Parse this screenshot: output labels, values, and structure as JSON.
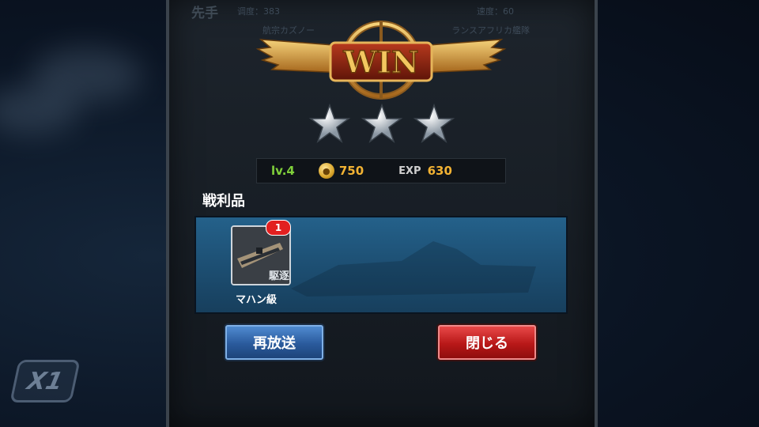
{
  "background": {
    "side_button_label": "X1"
  },
  "top_bar": {
    "left_title": "先手",
    "left_stat": "调度：383",
    "right_stat": "速度：60",
    "left_name": "航宗カズノー",
    "right_name": "ランスアフリカ艦隊"
  },
  "emblem": {
    "text": "WIN"
  },
  "stars": {
    "count": 3,
    "max": 3
  },
  "stats": {
    "level": "lv.4",
    "coin_icon": "coin-icon",
    "gold": "750",
    "exp_label": "EXP",
    "exp": "630"
  },
  "loot": {
    "title": "戦利品",
    "items": [
      {
        "name": "マハン級",
        "count": "1",
        "type_label": "駆逐"
      }
    ]
  },
  "buttons": {
    "replay": "再放送",
    "close": "閉じる"
  },
  "colors": {
    "level": "#7fcf3a",
    "gold": "#f2b233",
    "replay_button": "#2a5a9c",
    "close_button": "#b81818"
  }
}
